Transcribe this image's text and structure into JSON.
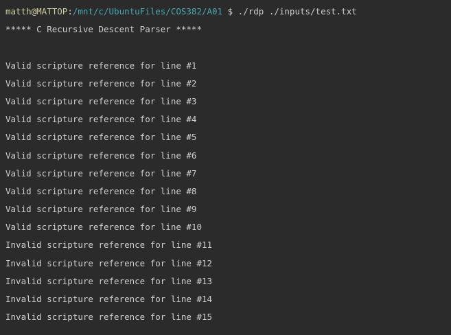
{
  "prompt": {
    "user_host": "matth@MATTOP",
    "separator": ":",
    "path": "/mnt/c/UbuntuFiles/COS382/A01",
    "symbol": " $ ",
    "command": "./rdp ./inputs/test.txt"
  },
  "banner": "***** C Recursive Descent Parser *****",
  "output_lines": [
    "Valid scripture reference for line #1",
    "Valid scripture reference for line #2",
    "Valid scripture reference for line #3",
    "Valid scripture reference for line #4",
    "Valid scripture reference for line #5",
    "Valid scripture reference for line #6",
    "Valid scripture reference for line #7",
    "Valid scripture reference for line #8",
    "Valid scripture reference for line #9",
    "Valid scripture reference for line #10",
    "Invalid scripture reference for line #11",
    "Invalid scripture reference for line #12",
    "Invalid scripture reference for line #13",
    "Invalid scripture reference for line #14",
    "Invalid scripture reference for line #15"
  ],
  "colors": {
    "background": "#2b2b2b",
    "text": "#cfcfcf",
    "user_host": "#cfcfa0",
    "path": "#4aa8b3"
  }
}
